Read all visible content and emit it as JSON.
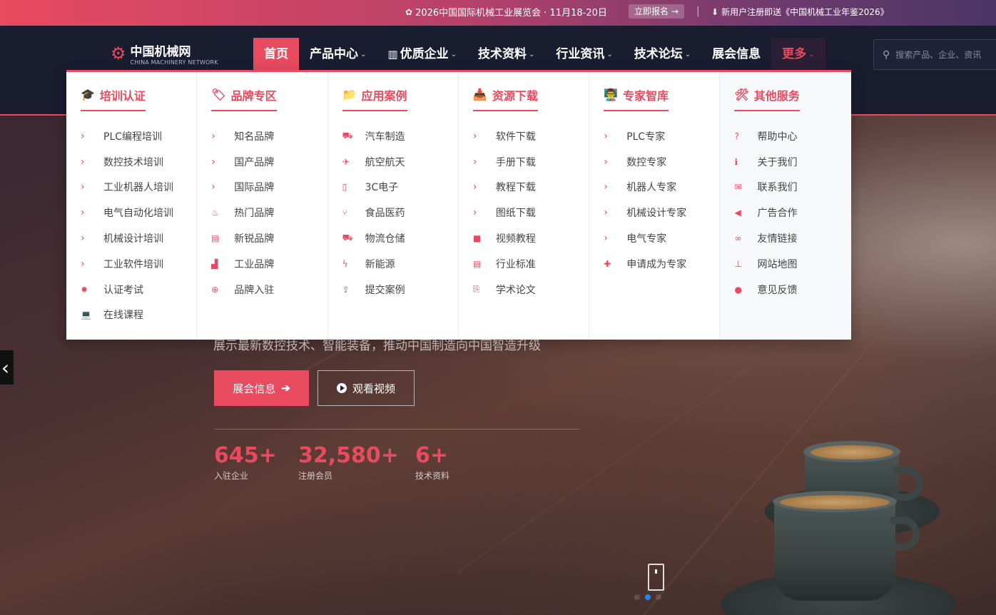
{
  "colors": {
    "accent": "#e84a5f",
    "nav_bg": "#1a1c30",
    "dropdown_bg": "#ffffff"
  },
  "topbar": {
    "expo_icon": "gear-icon",
    "expo_text": "2026中国国际机械工业展览会 · 11月18-20日",
    "signup_label": "立即报名 →",
    "separator": "|",
    "gift_icon": "download-icon",
    "gift_text": "新用户注册即送《中国机械工业年鉴2026》"
  },
  "logo": {
    "cn": "中国机械网",
    "en": "CHINA MACHINERY NETWORK",
    "icon": "gears-icon"
  },
  "nav": {
    "items": [
      {
        "label": "首页",
        "active": true
      },
      {
        "label": "产品中心",
        "chevron": "⌄"
      },
      {
        "label": "优质企业",
        "chevron": "⌄",
        "icon": "building-icon"
      },
      {
        "label": "技术资料",
        "chevron": "⌄"
      },
      {
        "label": "行业资讯",
        "chevron": "⌄"
      },
      {
        "label": "技术论坛",
        "chevron": "⌄"
      },
      {
        "label": "展会信息"
      },
      {
        "label": "更多",
        "chevron": "⌄"
      }
    ]
  },
  "search": {
    "placeholder": "搜索产品、企业、资讯"
  },
  "mega_menu": {
    "columns": [
      {
        "title": "培训认证",
        "icon": "graduation-cap-icon",
        "items": [
          {
            "label": "PLC编程培训",
            "icon": "chevron-right-icon"
          },
          {
            "label": "数控技术培训",
            "icon": "chevron-right-icon"
          },
          {
            "label": "工业机器人培训",
            "icon": "chevron-right-icon"
          },
          {
            "label": "电气自动化培训",
            "icon": "chevron-right-icon"
          },
          {
            "label": "机械设计培训",
            "icon": "chevron-right-icon"
          },
          {
            "label": "工业软件培训",
            "icon": "chevron-right-icon"
          },
          {
            "label": "认证考试",
            "icon": "certificate-icon"
          },
          {
            "label": "在线课程",
            "icon": "laptop-icon"
          }
        ]
      },
      {
        "title": "品牌专区",
        "icon": "tag-icon",
        "items": [
          {
            "label": "知名品牌",
            "icon": "chevron-right-icon"
          },
          {
            "label": "国产品牌",
            "icon": "chevron-right-icon"
          },
          {
            "label": "国际品牌",
            "icon": "chevron-right-icon"
          },
          {
            "label": "热门品牌",
            "icon": "fire-icon"
          },
          {
            "label": "新锐品牌",
            "icon": "newspaper-icon"
          },
          {
            "label": "工业品牌",
            "icon": "industry-icon"
          },
          {
            "label": "品牌入驻",
            "icon": "plus-circle-icon"
          }
        ]
      },
      {
        "title": "应用案例",
        "icon": "folder-icon",
        "items": [
          {
            "label": "汽车制造",
            "icon": "car-icon"
          },
          {
            "label": "航空航天",
            "icon": "plane-icon"
          },
          {
            "label": "3C电子",
            "icon": "mobile-icon"
          },
          {
            "label": "食品医药",
            "icon": "cutlery-icon"
          },
          {
            "label": "物流仓储",
            "icon": "truck-icon"
          },
          {
            "label": "新能源",
            "icon": "bolt-icon"
          },
          {
            "label": "提交案例",
            "icon": "upload-icon"
          }
        ]
      },
      {
        "title": "资源下载",
        "icon": "inbox-download-icon",
        "items": [
          {
            "label": "软件下载",
            "icon": "chevron-right-icon"
          },
          {
            "label": "手册下载",
            "icon": "chevron-right-icon"
          },
          {
            "label": "教程下载",
            "icon": "chevron-right-icon"
          },
          {
            "label": "图纸下载",
            "icon": "chevron-right-icon"
          },
          {
            "label": "视频教程",
            "icon": "video-camera-icon"
          },
          {
            "label": "行业标准",
            "icon": "file-text-icon"
          },
          {
            "label": "学术论文",
            "icon": "file-pdf-icon"
          }
        ]
      },
      {
        "title": "专家智库",
        "icon": "expert-board-icon",
        "items": [
          {
            "label": "PLC专家",
            "icon": "chevron-right-icon"
          },
          {
            "label": "数控专家",
            "icon": "chevron-right-icon"
          },
          {
            "label": "机器人专家",
            "icon": "chevron-right-icon"
          },
          {
            "label": "机械设计专家",
            "icon": "chevron-right-icon"
          },
          {
            "label": "电气专家",
            "icon": "chevron-right-icon"
          },
          {
            "label": "申请成为专家",
            "icon": "user-plus-icon"
          }
        ]
      },
      {
        "title": "其他服务",
        "icon": "tools-icon",
        "items": [
          {
            "label": "帮助中心",
            "icon": "question-circle-icon"
          },
          {
            "label": "关于我们",
            "icon": "info-circle-icon"
          },
          {
            "label": "联系我们",
            "icon": "envelope-icon"
          },
          {
            "label": "广告合作",
            "icon": "bullhorn-icon"
          },
          {
            "label": "友情链接",
            "icon": "link-icon"
          },
          {
            "label": "网站地图",
            "icon": "sitemap-icon"
          },
          {
            "label": "意见反馈",
            "icon": "comment-icon"
          }
        ]
      }
    ]
  },
  "hero": {
    "subtitle": "展示最新数控技术、智能装备，推动中国制造向中国智造升级",
    "primary_button": "展会信息",
    "secondary_button": "观看视频",
    "stats": [
      {
        "value": "645+",
        "label": "入驻企业"
      },
      {
        "value": "32,580+",
        "label": "注册会员"
      },
      {
        "value": "6+",
        "label": "技术资料"
      }
    ],
    "prev_arrow": "‹",
    "slide_count": 3,
    "active_slide": 2
  }
}
